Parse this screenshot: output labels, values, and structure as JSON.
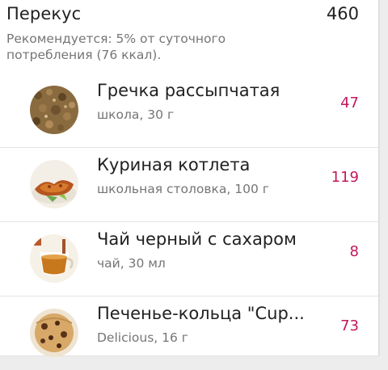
{
  "meal": {
    "title": "Перекус",
    "total": "460",
    "note": "Рекомендуется: 5% от суточного потребления (76 ккал)."
  },
  "items": [
    {
      "name": "Гречка рассыпчатая",
      "sub": "школа, 30 г",
      "kcal": "47",
      "icon": "buckwheat-icon"
    },
    {
      "name": "Куриная котлета",
      "sub": "школьная столовка, 100 г",
      "kcal": "119",
      "icon": "chicken-cutlet-icon"
    },
    {
      "name": "Чай черный с сахаром",
      "sub": "чай, 30 мл",
      "kcal": "8",
      "icon": "tea-cup-icon"
    },
    {
      "name": "Печенье-кольца \"Cup...",
      "sub": "Delicious, 16 г",
      "kcal": "73",
      "icon": "cookies-icon"
    }
  ],
  "colors": {
    "accent": "#c2185b",
    "primary_text": "#212121",
    "secondary_text": "#757575",
    "divider": "#e3e3e3"
  }
}
